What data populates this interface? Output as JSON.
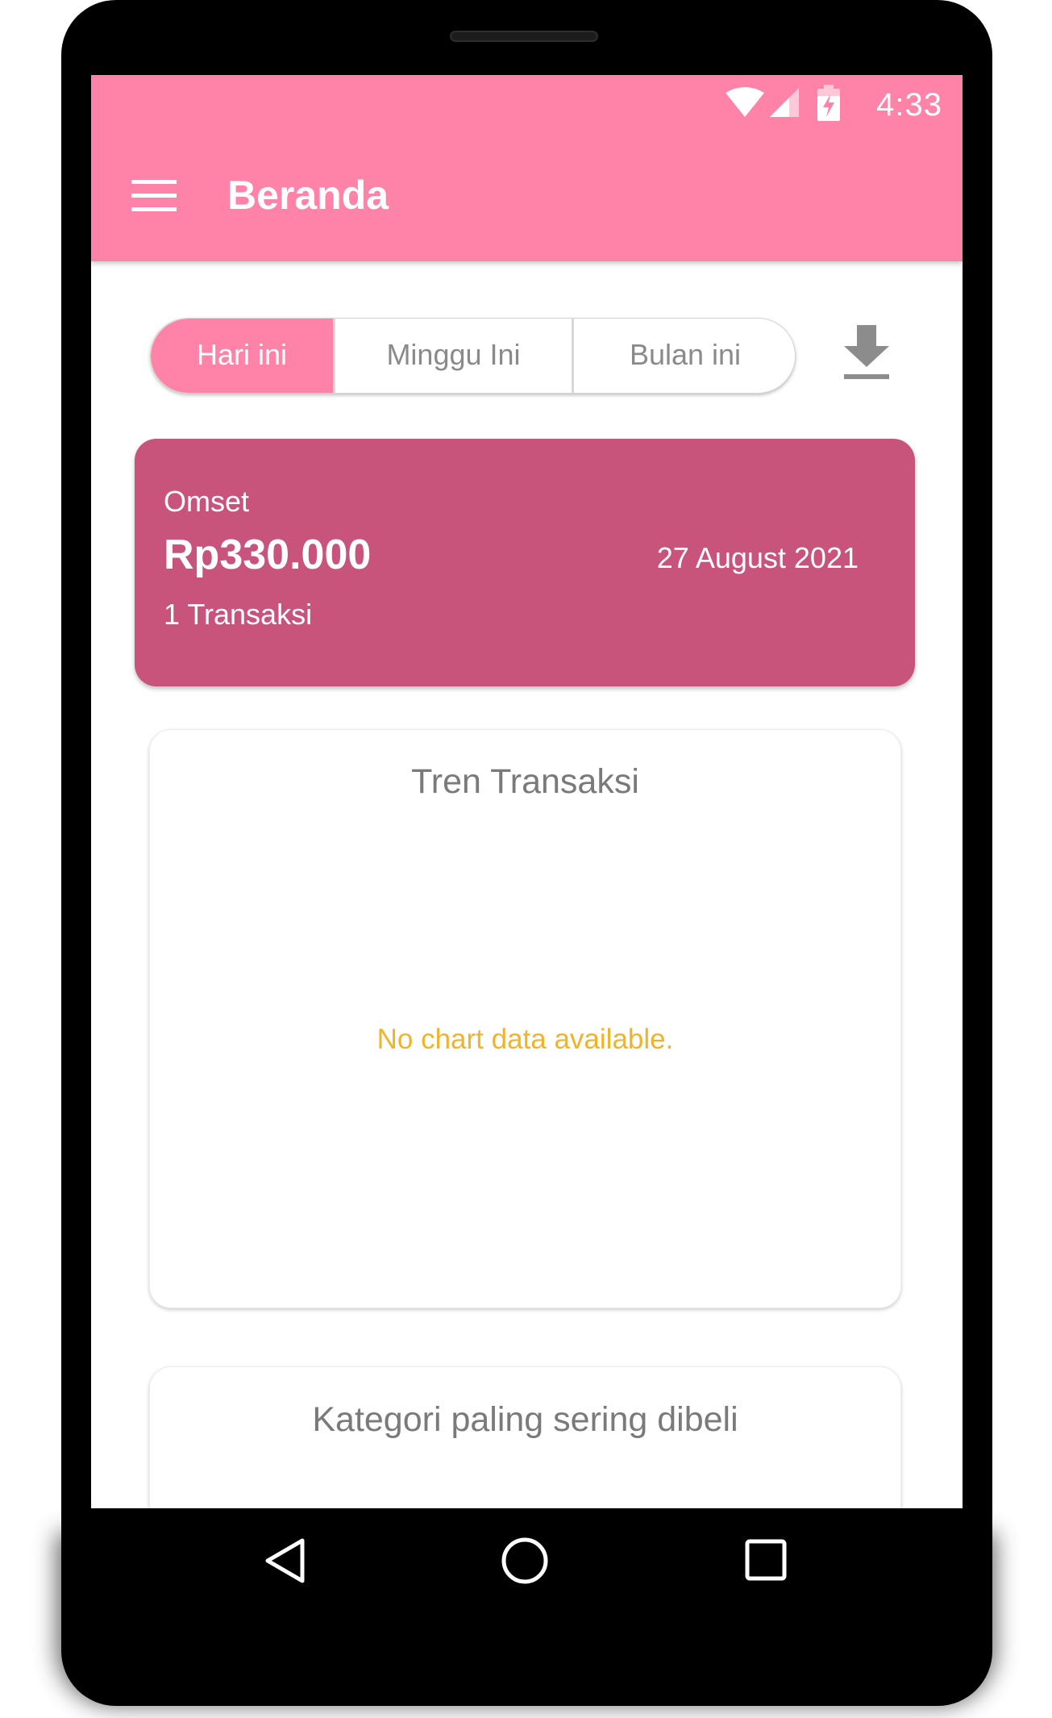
{
  "status_bar": {
    "time": "4:33",
    "icons": [
      "wifi-icon",
      "cell-signal-icon",
      "battery-charging-icon"
    ]
  },
  "app_bar": {
    "title": "Beranda",
    "menu_icon": "hamburger-menu-icon",
    "color": "#ff83a8"
  },
  "period_filter": {
    "options": [
      "Hari ini",
      "Minggu Ini",
      "Bulan ini"
    ],
    "selected": "Hari ini",
    "download_icon": "download-icon"
  },
  "omset_card": {
    "label": "Omset",
    "amount": "Rp330.000",
    "transactions": "1 Transaksi",
    "date": "27 August 2021",
    "color": "#c8537b"
  },
  "trend_card": {
    "title": "Tren Transaksi",
    "empty_message": "No chart data available.",
    "empty_color": "#f0b429"
  },
  "category_card": {
    "title": "Kategori paling sering dibeli"
  },
  "nav_bar": {
    "icons": [
      "back-icon",
      "home-icon",
      "recents-icon"
    ]
  }
}
